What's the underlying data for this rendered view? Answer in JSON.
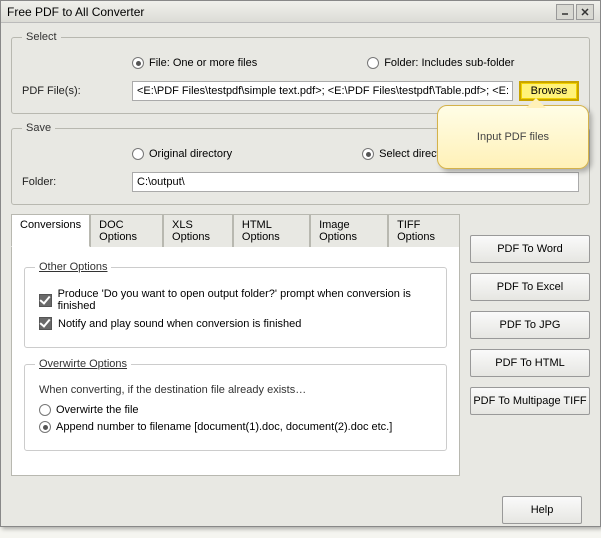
{
  "window": {
    "title": "Free PDF to All Converter"
  },
  "select": {
    "legend": "Select",
    "file_radio": "File:  One or more files",
    "folder_radio": "Folder: Includes sub-folder",
    "label": "PDF File(s):",
    "input_value": "<E:\\PDF Files\\testpdf\\simple text.pdf>; <E:\\PDF Files\\testpdf\\Table.pdf>; <E:\\PDF",
    "browse": "Browse"
  },
  "save": {
    "legend": "Save",
    "original_radio": "Original directory",
    "select_radio": "Select directory",
    "folder_label": "Folder:",
    "folder_value": "C:\\output\\"
  },
  "tabs": {
    "conversions": "Conversions",
    "doc": "DOC Options",
    "xls": "XLS Options",
    "html": "HTML Options",
    "image": "Image Options",
    "tiff": "TIFF Options"
  },
  "other": {
    "legend": "Other Options",
    "prompt": "Produce 'Do you want to open output folder?' prompt when conversion is finished",
    "notify": "Notify and play sound when conversion is finished"
  },
  "overwrite": {
    "legend": "Overwirte Options",
    "desc": "When converting, if the destination file already exists…",
    "overwrite_file": "Overwirte the file",
    "append": "Append number to filename  [document(1).doc, document(2).doc etc.]"
  },
  "actions": {
    "word": "PDF To Word",
    "excel": "PDF To Excel",
    "jpg": "PDF To JPG",
    "html": "PDF To HTML",
    "tiff": "PDF To Multipage TIFF",
    "help": "Help"
  },
  "callout": "Input PDF files"
}
